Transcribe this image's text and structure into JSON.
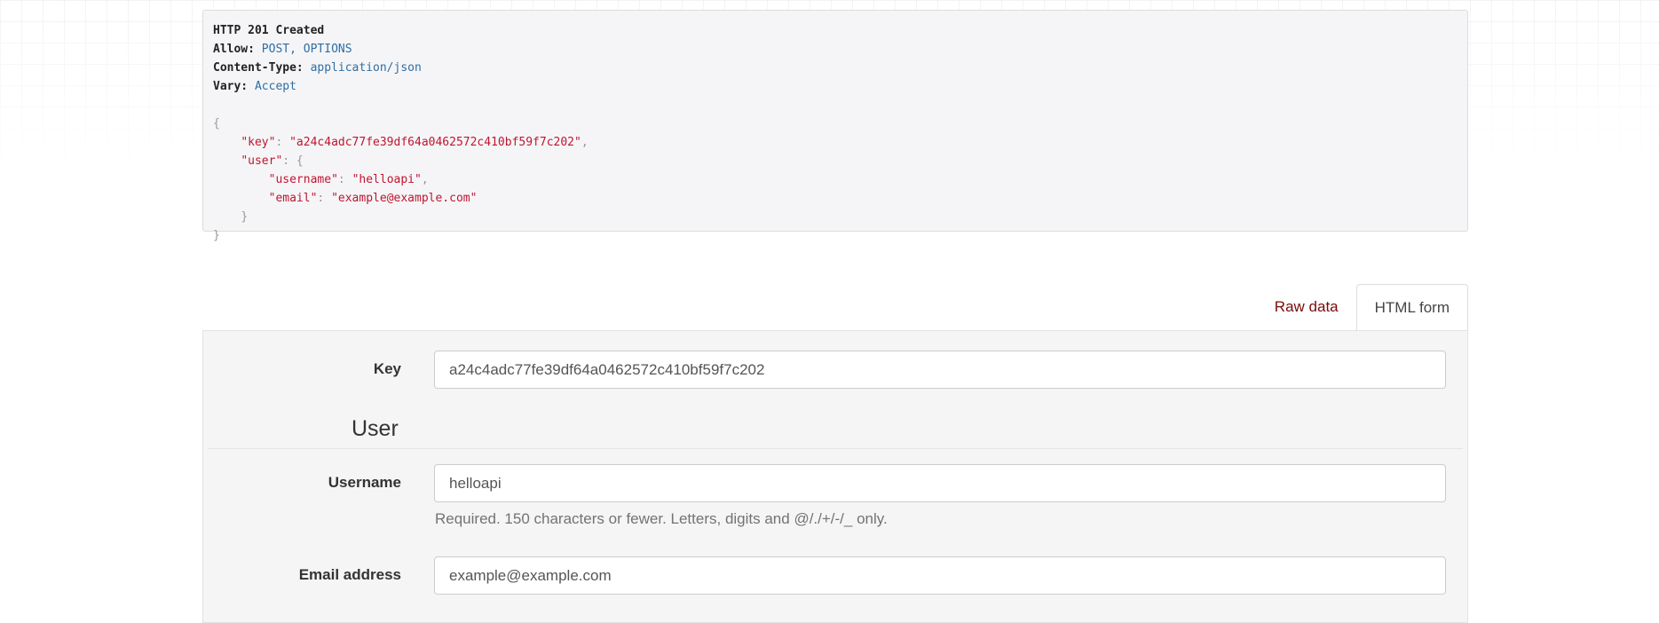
{
  "response": {
    "status_line": "HTTP 201 Created",
    "headers": [
      {
        "name": "Allow:",
        "value": "POST, OPTIONS"
      },
      {
        "name": "Content-Type:",
        "value": "application/json"
      },
      {
        "name": "Vary:",
        "value": "Accept"
      }
    ],
    "body": {
      "key_name": "\"key\"",
      "key_value": "\"a24c4adc77fe39df64a0462572c410bf59f7c202\"",
      "user_name": "\"user\"",
      "username_name": "\"username\"",
      "username_value": "\"helloapi\"",
      "email_name": "\"email\"",
      "email_value": "\"example@example.com\""
    }
  },
  "tabs": {
    "raw_data": "Raw data",
    "html_form": "HTML form"
  },
  "form": {
    "key_label": "Key",
    "key_value": "a24c4adc77fe39df64a0462572c410bf59f7c202",
    "user_section": "User",
    "username_label": "Username",
    "username_value": "helloapi",
    "username_help": "Required. 150 characters or fewer. Letters, digits and @/./+/-/_ only.",
    "email_label": "Email address",
    "email_value": "example@example.com"
  }
}
